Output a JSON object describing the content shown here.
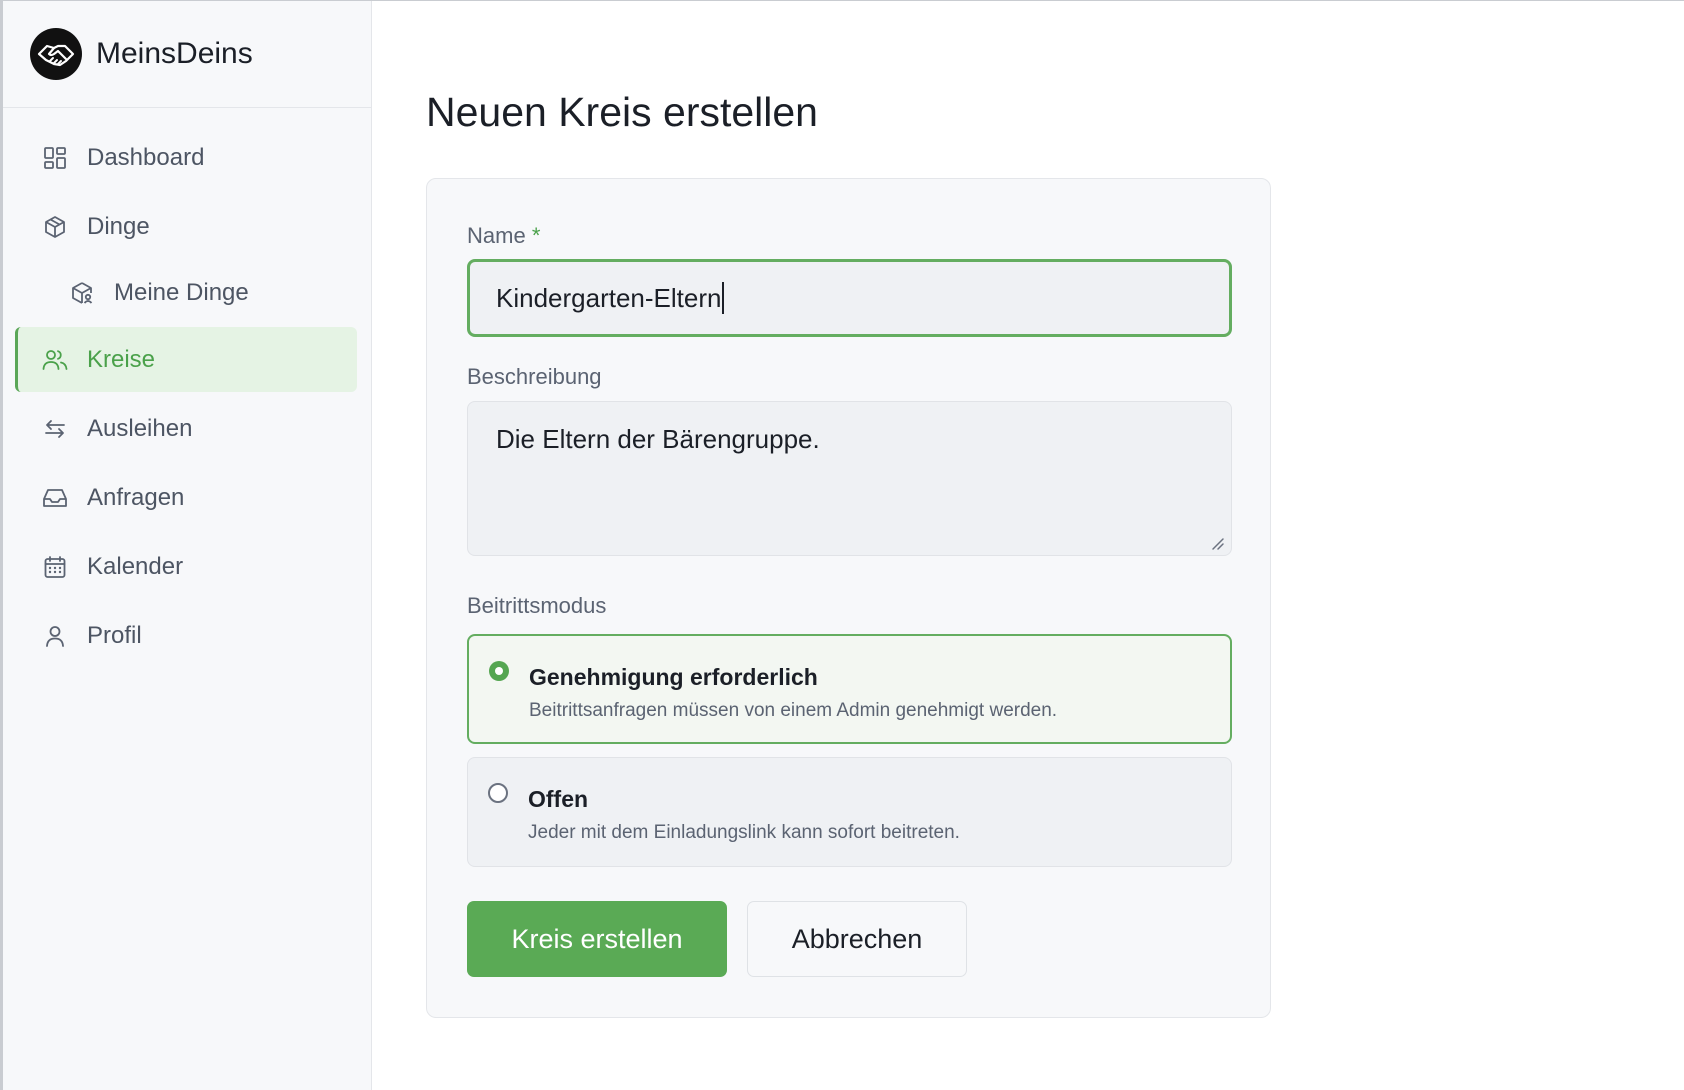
{
  "brand": {
    "name": "MeinsDeins",
    "logo_icon": "handshake-icon"
  },
  "sidebar": {
    "items": [
      {
        "label": "Dashboard",
        "icon": "dashboard-icon"
      },
      {
        "label": "Dinge",
        "icon": "box-icon"
      },
      {
        "label": "Meine Dinge",
        "icon": "box-user-icon"
      },
      {
        "label": "Kreise",
        "icon": "users-icon",
        "active": true
      },
      {
        "label": "Ausleihen",
        "icon": "arrows-exchange-icon"
      },
      {
        "label": "Anfragen",
        "icon": "inbox-icon"
      },
      {
        "label": "Kalender",
        "icon": "calendar-icon"
      },
      {
        "label": "Profil",
        "icon": "user-icon"
      }
    ]
  },
  "page": {
    "title": "Neuen Kreis erstellen"
  },
  "form": {
    "name_label": "Name",
    "name_required_marker": "*",
    "name_value": "Kindergarten-Eltern",
    "description_label": "Beschreibung",
    "description_value": "Die Eltern der Bärengruppe.",
    "join_mode_label": "Beitrittsmodus",
    "options": [
      {
        "title": "Genehmigung erforderlich",
        "description": "Beitrittsanfragen müssen von einem Admin genehmigt werden.",
        "selected": true
      },
      {
        "title": "Offen",
        "description": "Jeder mit dem Einladungslink kann sofort beitreten.",
        "selected": false
      }
    ],
    "submit_label": "Kreis erstellen",
    "cancel_label": "Abbrechen"
  },
  "colors": {
    "accent": "#5aaa55",
    "active_bg": "#e5f3e4",
    "text": "#1b1f27"
  }
}
